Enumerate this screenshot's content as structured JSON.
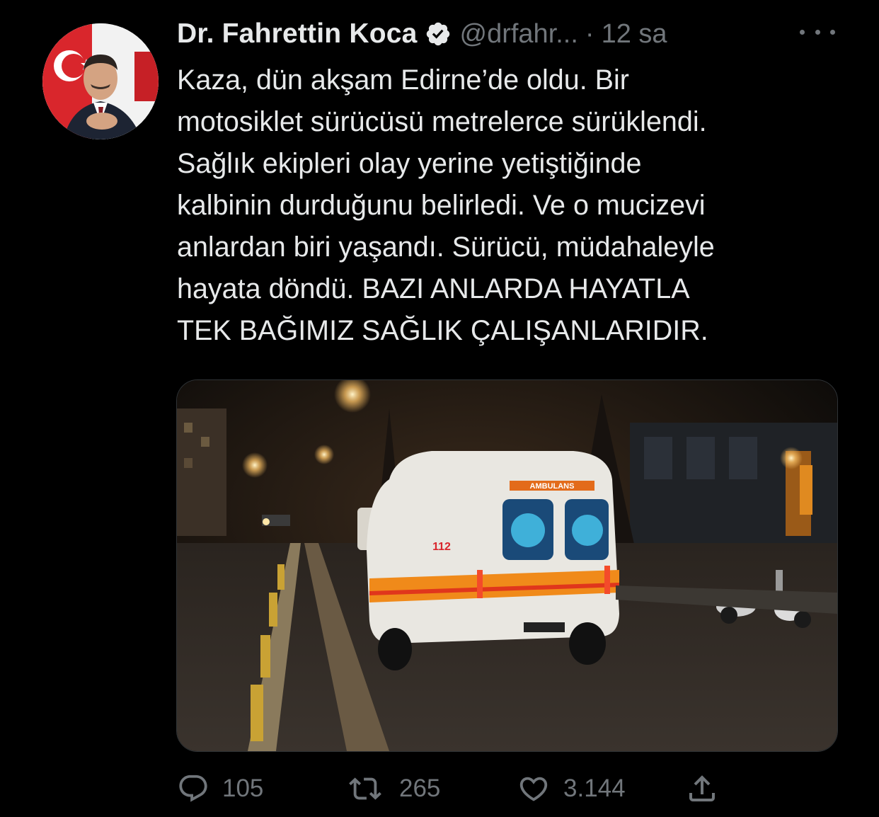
{
  "tweet": {
    "author": {
      "display_name": "Dr. Fahrettin Koca",
      "handle": "@drfahr...",
      "verified": true
    },
    "separator": "·",
    "time": "12 sa",
    "text_lines": [
      "Kaza, dün akşam Edirne’de oldu. Bir",
      "motosiklet sürücüsü metrelerce sürüklendi.",
      "Sağlık ekipleri olay yerine yetiştiğinde",
      "kalbinin durduğunu belirledi. Ve o mucizevi",
      "anlardan biri yaşandı. Sürücü, müdahaleyle",
      "hayata döndü. BAZI ANLARDA HAYATLA",
      "TEK BAĞIMIZ SAĞLIK ÇALIŞANLARIDIR."
    ],
    "media": {
      "ambulance_label": "AMBULANS",
      "ambulance_number": "112"
    },
    "actions": {
      "reply_count": "105",
      "retweet_count": "265",
      "like_count": "3.144"
    }
  },
  "colors": {
    "background": "#000000",
    "text_primary": "#e7e9ea",
    "text_secondary": "#71767b",
    "verified_badge": "#e7e9ea"
  },
  "icons": {
    "reply": "reply-icon",
    "retweet": "retweet-icon",
    "like": "heart-icon",
    "share": "share-icon",
    "more": "more-icon",
    "verified": "verified-badge-icon"
  }
}
